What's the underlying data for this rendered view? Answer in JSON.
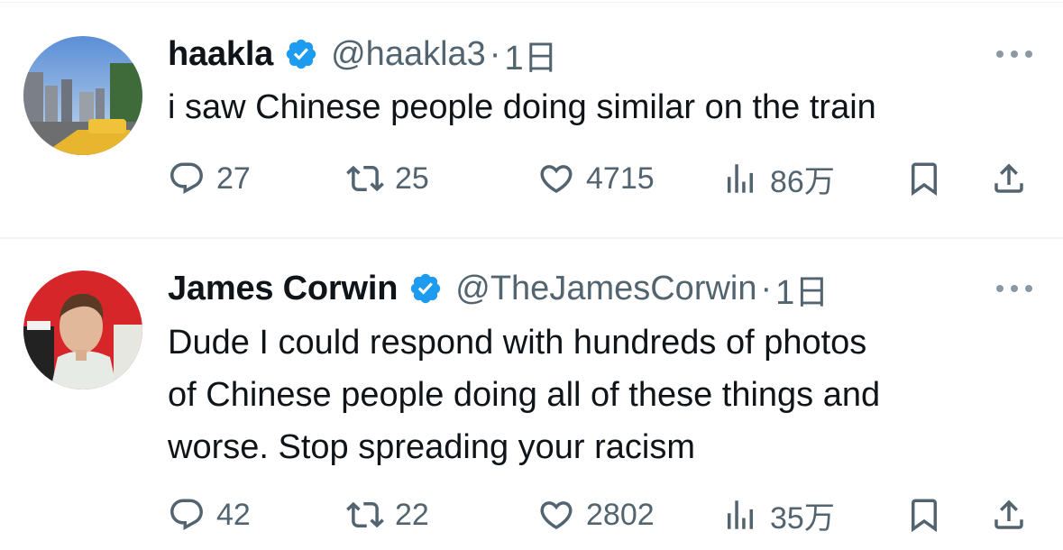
{
  "tweets": [
    {
      "name": "haakla",
      "handle": "@haakla3",
      "separator": "·",
      "time": "1日",
      "text_lines": [
        "i saw Chinese people doing similar on the train"
      ],
      "replies": "27",
      "retweets": "25",
      "likes": "4715",
      "views": "86万"
    },
    {
      "name": "James Corwin",
      "handle": "@TheJamesCorwin",
      "separator": "·",
      "time": "1日",
      "text_lines": [
        "Dude I could respond with hundreds of photos",
        "of Chinese people doing all of these things and",
        "worse. Stop spreading your racism"
      ],
      "replies": "42",
      "retweets": "22",
      "likes": "2802",
      "views": "35万"
    }
  ],
  "colors": {
    "verified": "#1d9bf0",
    "text": "#0f1419",
    "secondary": "#536471",
    "divider": "#eff3f4"
  },
  "icons": [
    "verified-badge-icon",
    "more-icon",
    "reply-icon",
    "retweet-icon",
    "like-icon",
    "views-icon",
    "bookmark-icon",
    "share-icon"
  ]
}
